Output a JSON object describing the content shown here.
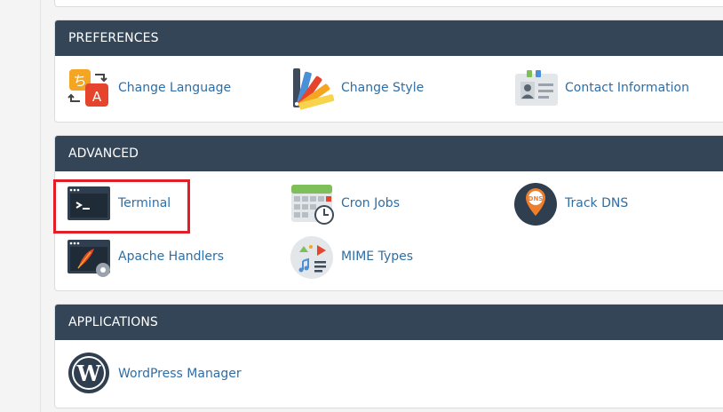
{
  "sections": {
    "preferences": {
      "title": "PREFERENCES",
      "items": [
        "Change Language",
        "Change Style",
        "Contact Information"
      ]
    },
    "advanced": {
      "title": "ADVANCED",
      "items": [
        "Terminal",
        "Cron Jobs",
        "Track DNS",
        "Apache Handlers",
        "MIME Types"
      ]
    },
    "applications": {
      "title": "APPLICATIONS",
      "items": [
        "WordPress Manager"
      ]
    }
  },
  "icons": {
    "change_language": "translate-icon",
    "change_style": "palette-icon",
    "contact_information": "contact-card-icon",
    "terminal": "terminal-icon",
    "cron_jobs": "calendar-clock-icon",
    "track_dns": "dns-pin-icon",
    "apache_handlers": "feather-gear-icon",
    "mime_types": "media-icon",
    "wordpress_manager": "wordpress-icon"
  },
  "colors": {
    "header_bg": "#344557",
    "link": "#2f6ea5",
    "highlight": "#e41e26"
  }
}
